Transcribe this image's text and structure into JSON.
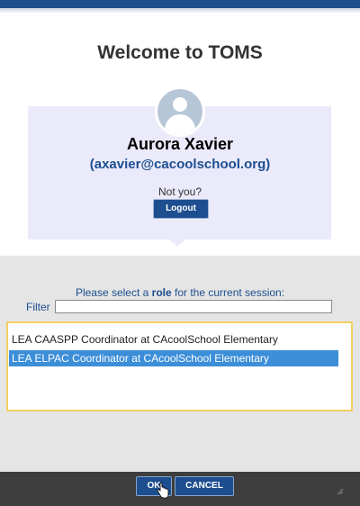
{
  "dialog": {
    "title": "Welcome to TOMS"
  },
  "user": {
    "name": "Aurora Xavier",
    "email": "(axavier@cacoolschool.org)",
    "not_you": "Not you?",
    "logout_label": "Logout",
    "avatar_icon": "user-avatar-icon"
  },
  "role_selection": {
    "prompt_prefix": "Please select a ",
    "prompt_bold": "role",
    "prompt_suffix": " for the current session:",
    "filter_label": "Filter",
    "filter_value": "",
    "roles": [
      {
        "label": "LEA CAASPP Coordinator at CAcoolSchool Elementary",
        "selected": false
      },
      {
        "label": "LEA ELPAC Coordinator at CAcoolSchool Elementary",
        "selected": true
      }
    ]
  },
  "footer": {
    "ok_label": "OK",
    "cancel_label": "CANCEL"
  },
  "colors": {
    "brand_blue": "#1d4e8f",
    "card_background": "#eaeafb",
    "selection_blue": "#3c8ed8",
    "list_border": "#f3cf62"
  }
}
